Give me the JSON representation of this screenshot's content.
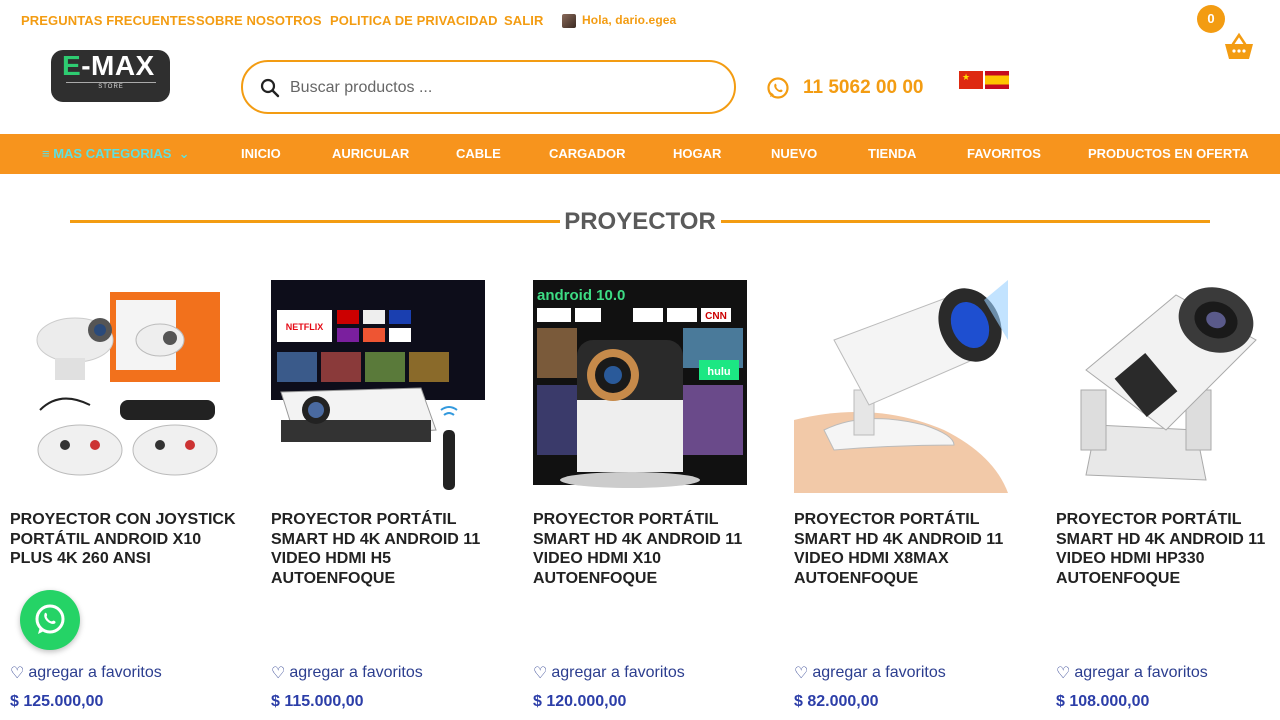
{
  "top_links": [
    "PREGUNTAS FRECUENTES",
    "SOBRE NOSOTROS",
    "POLITICA DE PRIVACIDAD",
    "SALIR"
  ],
  "greeting": "Hola, dario.egea",
  "cart_count": "0",
  "logo": {
    "text_e": "E",
    "text_rest": "-MAX",
    "sub": "STORE"
  },
  "search": {
    "placeholder": "Buscar productos ..."
  },
  "phone": "11 5062 00 00",
  "nav": {
    "categories": "MAS CATEGORIAS",
    "items": [
      "INICIO",
      "AURICULAR",
      "CABLE",
      "CARGADOR",
      "HOGAR",
      "NUEVO",
      "TIENDA",
      "FAVORITOS",
      "PRODUCTOS EN OFERTA"
    ]
  },
  "section_title": "PROYECTOR",
  "products": [
    {
      "title": "PROYECTOR CON JOYSTICK PORTÁTIL ANDROID X10 PLUS 4K 260 ANSI",
      "fav": "agregar a favoritos",
      "price": "$ 125.000,00"
    },
    {
      "title": "PROYECTOR PORTÁTIL SMART HD 4K ANDROID 11 VIDEO HDMI H5 AUTOENFOQUE",
      "fav": "agregar a favoritos",
      "price": "$ 115.000,00"
    },
    {
      "title": "PROYECTOR PORTÁTIL SMART HD 4K ANDROID 11 VIDEO HDMI X10 AUTOENFOQUE",
      "fav": "agregar a favoritos",
      "price": "$ 120.000,00"
    },
    {
      "title": "PROYECTOR PORTÁTIL SMART HD 4K ANDROID 11 VIDEO HDMI X8MAX AUTOENFOQUE",
      "fav": "agregar a favoritos",
      "price": "$ 82.000,00"
    },
    {
      "title": "PROYECTOR PORTÁTIL SMART HD 4K ANDROID 11 VIDEO HDMI HP330 AUTOENFOQUE",
      "fav": "agregar a favoritos",
      "price": "$ 108.000,00"
    }
  ],
  "image_texts": {
    "netflix": "NETFLIX",
    "android": "android 10.0",
    "hulu": "hulu",
    "cnn": "CNN"
  },
  "colors": {
    "accent": "#f7941d",
    "price": "#2c3ea8",
    "whatsapp": "#25d366"
  }
}
